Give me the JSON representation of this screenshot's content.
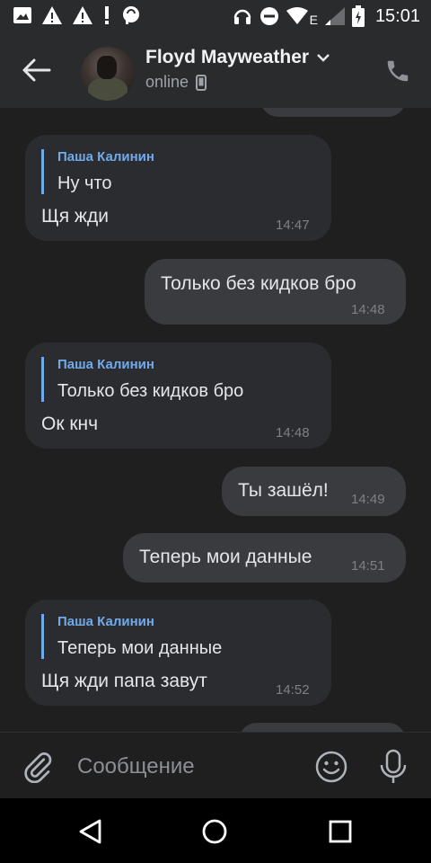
{
  "status_bar": {
    "time": "15:01",
    "network_label": "E",
    "icons": [
      "image-icon",
      "warning-icon",
      "warning-icon",
      "alert-icon",
      "cloud-sync-icon",
      "headphones-icon",
      "do-not-disturb-icon",
      "wifi-icon",
      "signal-icon",
      "battery-charging-icon"
    ]
  },
  "header": {
    "contact_name": "Floyd Mayweather",
    "status": "online"
  },
  "messages": [
    {
      "direction": "in",
      "quote_author": "Паша Калинин",
      "quote_text": "Ну что",
      "text": "Щя жди",
      "time": "14:47"
    },
    {
      "direction": "out",
      "text": "Только без кидков бро",
      "time": "14:48"
    },
    {
      "direction": "in",
      "quote_author": "Паша Калинин",
      "quote_text": "Только без кидков бро",
      "text": "Ок кнч",
      "time": "14:48"
    },
    {
      "direction": "out",
      "text": "Ты зашёл!",
      "time": "14:49"
    },
    {
      "direction": "out",
      "text": "Теперь мои данные",
      "time": "14:51"
    },
    {
      "direction": "in",
      "quote_author": "Паша Калинин",
      "quote_text": "Теперь мои данные",
      "text": "Щя жди папа завут",
      "time": "14:52"
    }
  ],
  "composer": {
    "placeholder": "Сообщение"
  },
  "colors": {
    "accent": "#71aaeb",
    "background": "#1f1f20",
    "bar": "#2a2b2d"
  }
}
